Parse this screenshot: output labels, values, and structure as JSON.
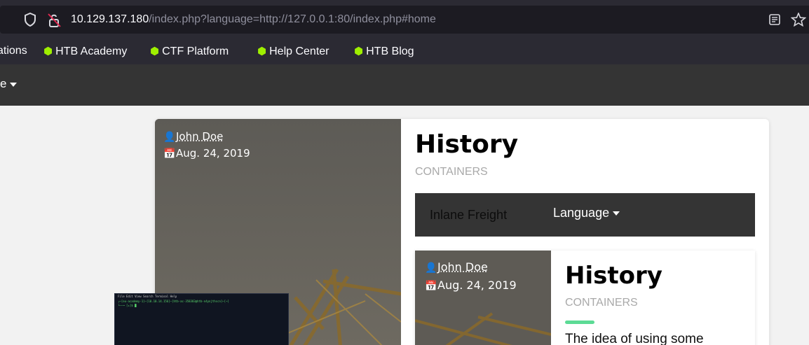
{
  "browser": {
    "url_host": "10.129.137.180",
    "url_path": "/index.php?language=http://127.0.0.1:80/index.php#home",
    "icons": [
      "shield-icon",
      "lock-broken-icon",
      "reader-view-icon",
      "bookmark-star-icon"
    ],
    "bookmarks": [
      {
        "label": "ations",
        "icon": ""
      },
      {
        "label": "HTB Academy",
        "icon": "cube-icon"
      },
      {
        "label": "CTF Platform",
        "icon": "cube-icon"
      },
      {
        "label": "Help Center",
        "icon": "cube-icon"
      },
      {
        "label": "HTB Blog",
        "icon": "cube-icon"
      }
    ]
  },
  "page": {
    "topnav_label": "e",
    "post": {
      "author": "John Doe",
      "date": "Aug. 24, 2019",
      "title": "History",
      "category": "CONTAINERS"
    },
    "inner_nav": {
      "brand": "Inlane Freight",
      "language": "Language"
    },
    "inner_post": {
      "author": "John Doe",
      "date": "Aug. 24, 2019",
      "title": "History",
      "category": "CONTAINERS",
      "excerpt": "The idea of using some"
    },
    "terminal": {
      "menu": "File  Edit  View  Search  Terminal  Help",
      "line1": "┌─[eu-academy-1]─[10.10.14.156]─[htb-ac-358383@htb-n4ynjthscn]─[~]",
      "line2": "└──╼ [★]$ █"
    },
    "colors": {
      "accent": "#5cdb95",
      "bookmark_icon": "#9fef00",
      "nav_bg": "#343434"
    }
  }
}
